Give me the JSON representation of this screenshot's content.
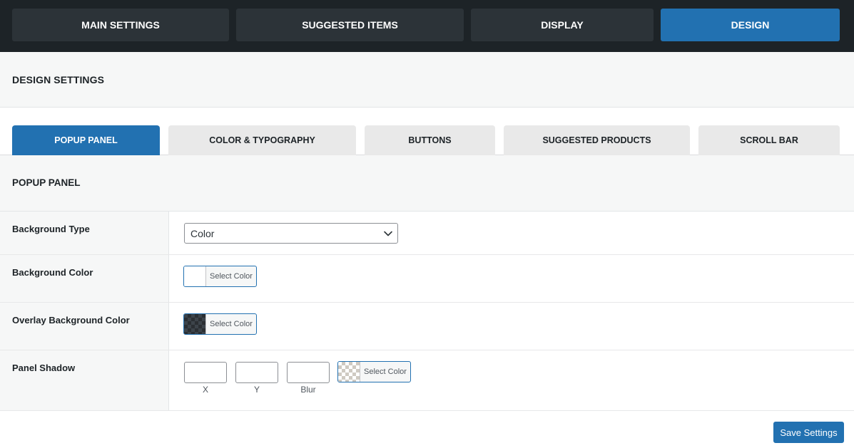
{
  "top_tabs": {
    "main_settings": "MAIN SETTINGS",
    "suggested_items": "SUGGESTED ITEMS",
    "display": "DISPLAY",
    "design": "DESIGN",
    "active": "DESIGN"
  },
  "design_settings": {
    "title": "DESIGN SETTINGS"
  },
  "sub_tabs": {
    "popup_panel": "POPUP PANEL",
    "color_typography": "COLOR & TYPOGRAPHY",
    "buttons": "BUTTONS",
    "suggested_products": "SUGGESTED PRODUCTS",
    "scroll_bar": "SCROLL BAR",
    "active": "POPUP PANEL"
  },
  "popup_panel": {
    "title": "POPUP PANEL",
    "background_type": {
      "label": "Background Type",
      "value": "Color"
    },
    "background_color": {
      "label": "Background Color",
      "button": "Select Color"
    },
    "overlay_background_color": {
      "label": "Overlay Background Color",
      "button": "Select Color"
    },
    "panel_shadow": {
      "label": "Panel Shadow",
      "x_label": "X",
      "y_label": "Y",
      "blur_label": "Blur",
      "x_value": "",
      "y_value": "",
      "blur_value": "",
      "button": "Select Color"
    }
  },
  "footer": {
    "save_label": "Save Settings"
  },
  "colors": {
    "accent": "#2271b1",
    "top_bar": "#1d2327",
    "inactive_top_tab": "#2c3338",
    "inactive_sub_tab": "#e9e9e9"
  },
  "icons": {
    "select_arrow": "chevron-down-icon"
  }
}
